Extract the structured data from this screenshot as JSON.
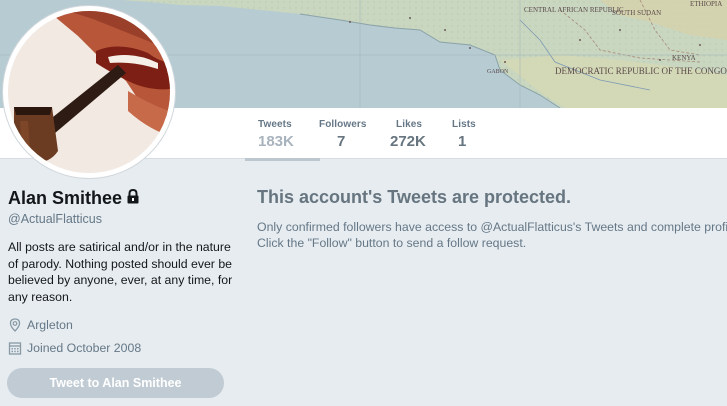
{
  "profile": {
    "name": "Alan Smithee",
    "handle": "@ActualFlatticus",
    "bio": "All posts are satirical and/or in the nature of parody. Nothing posted should ever be believed by anyone, ever, at any time, for any reason.",
    "location": "Argleton",
    "joined": "Joined October 2008",
    "tweet_button_label": "Tweet to Alan Smithee",
    "icons": {
      "lock": "lock-icon",
      "location": "location-pin-icon",
      "calendar": "calendar-icon"
    }
  },
  "banner": {
    "map_labels": [
      "CENTRAL AFRICAN REPUBLIC",
      "SOUTH SUDAN",
      "ETHIOPIA",
      "DEMOCRATIC REPUBLIC OF THE CONGO",
      "KENYA",
      "GABON"
    ]
  },
  "stats": [
    {
      "label": "Tweets",
      "value": "183K"
    },
    {
      "label": "Followers",
      "value": "7"
    },
    {
      "label": "Likes",
      "value": "272K"
    },
    {
      "label": "Lists",
      "value": "1"
    }
  ],
  "protected": {
    "title": "This account's Tweets are protected.",
    "line1": "Only confirmed followers have access to @ActualFlatticus's Tweets and complete profile.",
    "line2": "Click the \"Follow\" button to send a follow request."
  },
  "colors": {
    "background": "#e6ecf0",
    "button_disabled": "#c0cbd3",
    "muted_text": "#657786"
  }
}
